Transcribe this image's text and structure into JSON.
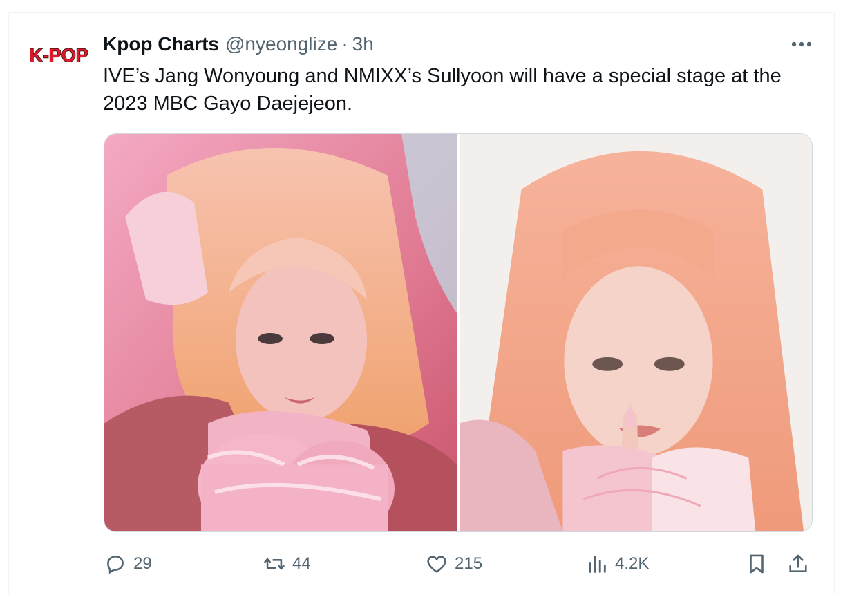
{
  "tweet": {
    "avatar_logo_text": "K-POP",
    "author_name": "Kpop Charts",
    "author_handle": "@nyeonglize",
    "separator": "·",
    "time": "3h",
    "text": "IVE’s Jang Wonyoung and NMIXX’s Sullyoon will have a special stage at the 2023 MBC Gayo Daejejeon.",
    "media": [
      {
        "alt": "photo-1"
      },
      {
        "alt": "photo-2"
      }
    ]
  },
  "actions": {
    "reply_count": "29",
    "retweet_count": "44",
    "like_count": "215",
    "view_count": "4.2K"
  },
  "colors": {
    "text_primary": "#0f1419",
    "text_secondary": "#536471",
    "border": "#cfd9de",
    "logo_red": "#e0192a"
  }
}
